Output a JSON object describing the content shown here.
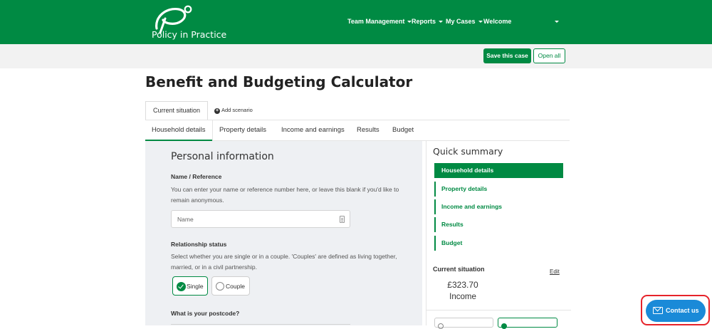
{
  "brand": {
    "logo_text": "Policy in Practice",
    "primary_color": "#008a43",
    "contact_color": "#1a8ad8",
    "highlight_color": "#e6232a"
  },
  "nav": {
    "items": [
      {
        "label": "Team Management",
        "has_dropdown": true
      },
      {
        "label": "Reports",
        "has_dropdown": true
      },
      {
        "label": "My Cases",
        "has_dropdown": true
      },
      {
        "label": "Welcome",
        "has_dropdown": false
      }
    ]
  },
  "toolbar": {
    "save_label": "Save this case",
    "open_label": "Open all"
  },
  "page": {
    "title": "Benefit and Budgeting Calculator"
  },
  "scenarios": {
    "current_tab": "Current situation",
    "add_label": "Add scenario"
  },
  "tabs": [
    {
      "label": "Household details",
      "active": true
    },
    {
      "label": "Property details",
      "active": false
    },
    {
      "label": "Income and earnings",
      "active": false
    },
    {
      "label": "Results",
      "active": false
    },
    {
      "label": "Budget",
      "active": false
    }
  ],
  "personal": {
    "section_title": "Personal information",
    "name_label": "Name / Reference",
    "name_help": "You can enter your name or reference number here, or leave this blank if you'd like to remain anonymous.",
    "name_placeholder": "Name",
    "name_value": "",
    "relationship_label": "Relationship status",
    "relationship_help": "Select whether you are single or in a couple. 'Couples' are defined as living together, married, or in a civil partnership.",
    "options": [
      {
        "label": "Single",
        "selected": true
      },
      {
        "label": "Couple",
        "selected": false
      }
    ],
    "postcode_label": "What is your postcode?"
  },
  "summary": {
    "title": "Quick summary",
    "items": [
      {
        "label": "Household details",
        "active": true
      },
      {
        "label": "Property details",
        "active": false
      },
      {
        "label": "Income and earnings",
        "active": false
      },
      {
        "label": "Results",
        "active": false
      },
      {
        "label": "Budget",
        "active": false
      }
    ],
    "current_label": "Current situation",
    "edit_label": "Edit",
    "amount": "£323.70",
    "amount_label": "Income"
  },
  "contact": {
    "label": "Contact us"
  }
}
